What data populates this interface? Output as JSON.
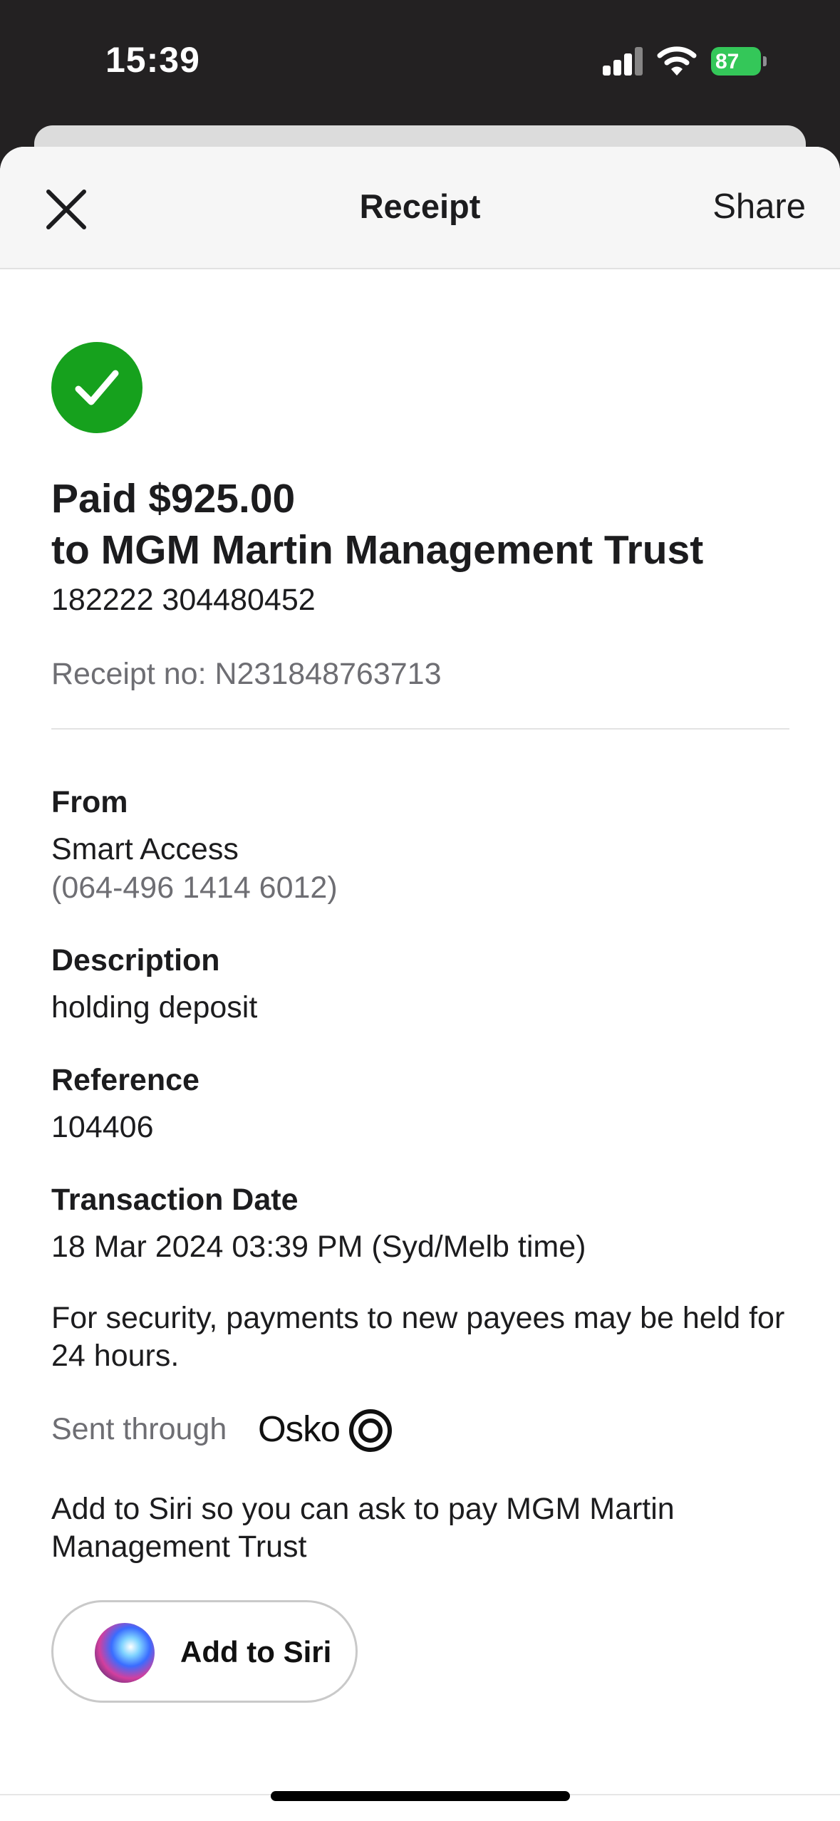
{
  "status_bar": {
    "time": "15:39",
    "battery": "87",
    "icons": [
      "signal-icon",
      "wifi-icon",
      "battery-charging-icon"
    ]
  },
  "nav": {
    "close_icon": "close-icon",
    "title": "Receipt",
    "share_label": "Share"
  },
  "receipt": {
    "status_icon": "checkmark-icon",
    "status_color": "#16a11d",
    "paid_line": "Paid $925.00",
    "payee_line": "to MGM Martin Management Trust",
    "payee_account": "182222 304480452",
    "receipt_no": "Receipt no: N231848763713"
  },
  "details": {
    "from_label": "From",
    "from_account": "Smart Access",
    "from_number": "(064-496 1414 6012)",
    "description_label": "Description",
    "description_value": "holding deposit",
    "reference_label": "Reference",
    "reference_value": "104406",
    "date_label": "Transaction Date",
    "date_value": "18 Mar 2024 03:39 PM (Syd/Melb time)"
  },
  "notice": "For security, payments to new payees may be held for 24 hours.",
  "sent_through": {
    "label": "Sent through",
    "brand": "Osko"
  },
  "siri": {
    "prompt": "Add to Siri so you can ask to pay MGM Martin Management Trust",
    "button_label": "Add to Siri"
  }
}
